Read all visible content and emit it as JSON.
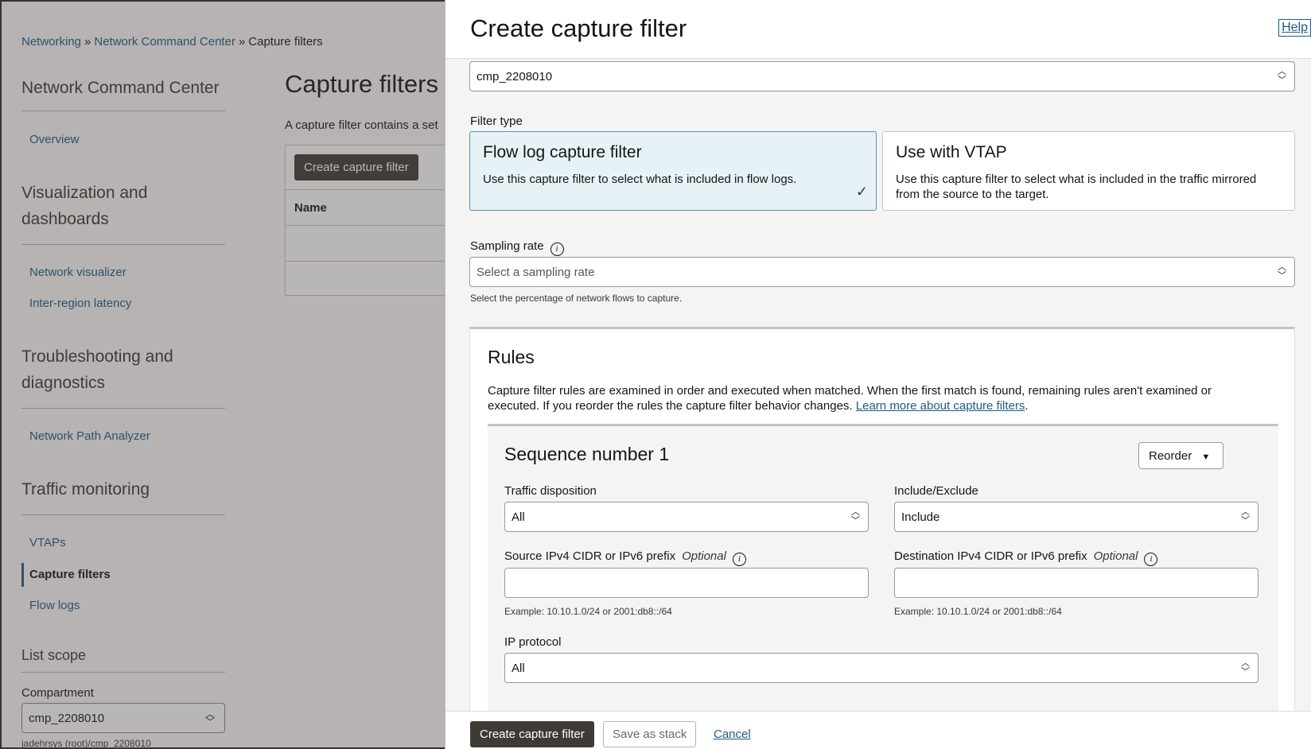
{
  "breadcrumb": {
    "items": [
      "Networking",
      "Network Command Center",
      "Capture filters"
    ],
    "separator": "»"
  },
  "sidebar": {
    "title": "Network Command Center",
    "overview": "Overview",
    "sections": [
      {
        "heading": "Visualization and dashboards",
        "links": [
          "Network visualizer",
          "Inter-region latency"
        ]
      },
      {
        "heading": "Troubleshooting and diagnostics",
        "links": [
          "Network Path Analyzer"
        ]
      },
      {
        "heading": "Traffic monitoring",
        "links": [
          "VTAPs",
          "Capture filters",
          "Flow logs"
        ]
      }
    ],
    "active": "Capture filters",
    "list_scope": {
      "heading": "List scope",
      "compartment_label": "Compartment",
      "compartment_value": "cmp_2208010",
      "compartment_path": "jadehrsys (root)/cmp_2208010"
    }
  },
  "main": {
    "title": "Capture filters",
    "description": "A capture filter contains a set",
    "create_button": "Create capture filter",
    "table_header": "Name"
  },
  "drawer": {
    "title": "Create capture filter",
    "help": "Help",
    "compartment_value": "cmp_2208010",
    "filter_type_label": "Filter type",
    "filter_types": [
      {
        "title": "Flow log capture filter",
        "description": "Use this capture filter to select what is included in flow logs.",
        "selected": true
      },
      {
        "title": "Use with VTAP",
        "description": "Use this capture filter to select what is included in the traffic mirrored from the source to the target.",
        "selected": false
      }
    ],
    "sampling_rate": {
      "label": "Sampling rate",
      "placeholder": "Select a sampling rate",
      "help": "Select the percentage of network flows to capture."
    },
    "rules": {
      "title": "Rules",
      "description": "Capture filter rules are examined in order and executed when matched. When the first match is found, remaining rules aren't examined or executed. If you reorder the rules the capture filter behavior changes. ",
      "learn_more": "Learn more about capture filters",
      "sequence": {
        "title": "Sequence number 1",
        "reorder": "Reorder",
        "traffic_disposition_label": "Traffic disposition",
        "traffic_disposition_value": "All",
        "include_exclude_label": "Include/Exclude",
        "include_exclude_value": "Include",
        "source_label": "Source IPv4 CIDR or IPv6 prefix",
        "destination_label": "Destination IPv4 CIDR or IPv6 prefix",
        "optional": "Optional",
        "example": "Example: 10.10.1.0/24 or 2001:db8::/64",
        "ip_protocol_label": "IP protocol",
        "ip_protocol_value": "All"
      }
    },
    "footer": {
      "create": "Create capture filter",
      "save_stack": "Save as stack",
      "cancel": "Cancel"
    }
  },
  "colors": {
    "link": "#1e5a86",
    "primary_button": "#3e3a36",
    "selected_card": "#e7f2f7"
  }
}
